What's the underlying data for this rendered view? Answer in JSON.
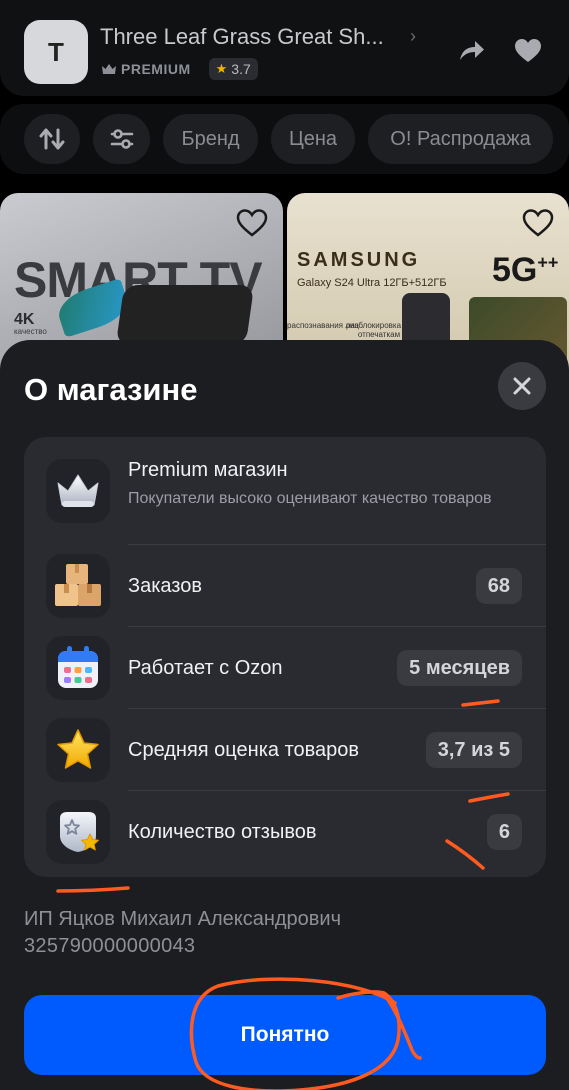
{
  "shop": {
    "logo_letter": "T",
    "title": "Three Leaf Grass Great Sh...",
    "premium_label": "PREMIUM",
    "rating": "3.7"
  },
  "filters": {
    "brand": "Бренд",
    "price": "Цена",
    "sale": "О! Распродажа"
  },
  "products": {
    "card1": {
      "headline": "SMART TV",
      "badge": "4K",
      "badge_sub": "качество"
    },
    "card2": {
      "brand": "SAMSUNG",
      "model": "Galaxy S24 Ultra 12ГБ+512ГБ",
      "network": "5G",
      "network_sup": "++",
      "feature1": "распознавания лиц",
      "feature2": "разблокировка по отпечаткам"
    }
  },
  "sheet": {
    "title": "О магазине",
    "rows": [
      {
        "label": "Premium магазин",
        "desc": "Покупатели высоко оценивают качество товаров",
        "icon": "crown-icon"
      },
      {
        "label": "Заказов",
        "value": "68",
        "icon": "boxes-icon"
      },
      {
        "label": "Работает с Ozon",
        "value": "5 месяцев",
        "icon": "calendar-icon"
      },
      {
        "label": "Средняя оценка товаров",
        "value": "3,7 из 5",
        "icon": "star-icon"
      },
      {
        "label": "Количество отзывов",
        "value": "6",
        "icon": "review-badge-icon"
      }
    ],
    "seller_name": "ИП Яцков Михаил Александрович",
    "seller_id": "325790000000043",
    "confirm_button": "Понятно"
  },
  "colors": {
    "sheet_bg": "#1c1d21",
    "card_bg": "#2a2b30",
    "primary": "#005bff",
    "annotation": "#ff5a1f"
  }
}
